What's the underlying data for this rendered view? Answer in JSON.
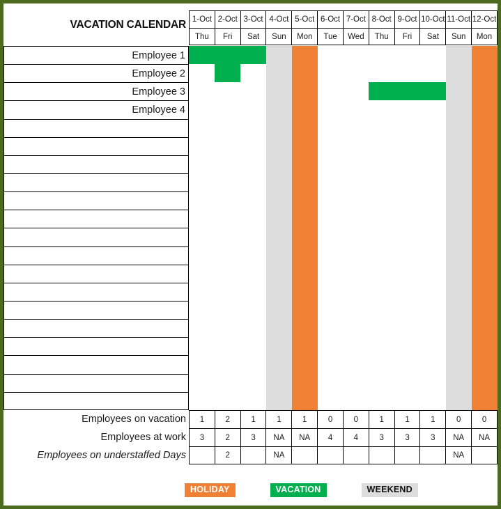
{
  "header": {
    "title": "VACATION CALENDAR"
  },
  "calendar": {
    "dates": [
      "1-Oct",
      "2-Oct",
      "3-Oct",
      "4-Oct",
      "5-Oct",
      "6-Oct",
      "7-Oct",
      "8-Oct",
      "9-Oct",
      "10-Oct",
      "11-Oct",
      "12-Oct"
    ],
    "days": [
      "Thu",
      "Fri",
      "Sat",
      "Sun",
      "Mon",
      "Tue",
      "Wed",
      "Thu",
      "Fri",
      "Sat",
      "Sun",
      "Mon"
    ],
    "day_types": [
      "work",
      "work",
      "work",
      "weekend",
      "holiday",
      "work",
      "work",
      "work",
      "work",
      "work",
      "weekend",
      "holiday"
    ],
    "employees": [
      {
        "name": "Employee 1",
        "vacation": [
          true,
          true,
          true,
          false,
          false,
          false,
          false,
          false,
          false,
          false,
          false,
          false
        ]
      },
      {
        "name": "Employee 2",
        "vacation": [
          false,
          true,
          false,
          false,
          false,
          false,
          false,
          false,
          false,
          false,
          false,
          false
        ]
      },
      {
        "name": "Employee 3",
        "vacation": [
          false,
          false,
          false,
          false,
          false,
          false,
          false,
          true,
          true,
          true,
          false,
          false
        ]
      },
      {
        "name": "Employee 4",
        "vacation": [
          false,
          false,
          false,
          false,
          false,
          false,
          false,
          false,
          false,
          false,
          false,
          false
        ]
      }
    ],
    "empty_row_count": 16
  },
  "summary": {
    "rows": [
      {
        "label": "Employees on vacation",
        "italic": false,
        "values": [
          "1",
          "2",
          "1",
          "1",
          "1",
          "0",
          "0",
          "1",
          "1",
          "1",
          "0",
          "0"
        ]
      },
      {
        "label": "Employees at work",
        "italic": false,
        "values": [
          "3",
          "2",
          "3",
          "NA",
          "NA",
          "4",
          "4",
          "3",
          "3",
          "3",
          "NA",
          "NA"
        ]
      },
      {
        "label": "Employees on understaffed Days",
        "italic": true,
        "values": [
          "",
          "2",
          "",
          "NA",
          "",
          "",
          "",
          "",
          "",
          "",
          "NA",
          ""
        ]
      }
    ]
  },
  "legend": {
    "items": [
      {
        "label": "HOLIDAY",
        "kind": "holiday",
        "color": "#f08033"
      },
      {
        "label": "VACATION",
        "kind": "vacation",
        "color": "#00b04f"
      },
      {
        "label": "WEEKEND",
        "kind": "weekend",
        "color": "#dddddd"
      }
    ]
  },
  "colors": {
    "border": "#4c6b1f",
    "vacation": "#00b04f",
    "holiday": "#f08033",
    "weekend": "#dddddd",
    "grid_line": "#000000"
  }
}
